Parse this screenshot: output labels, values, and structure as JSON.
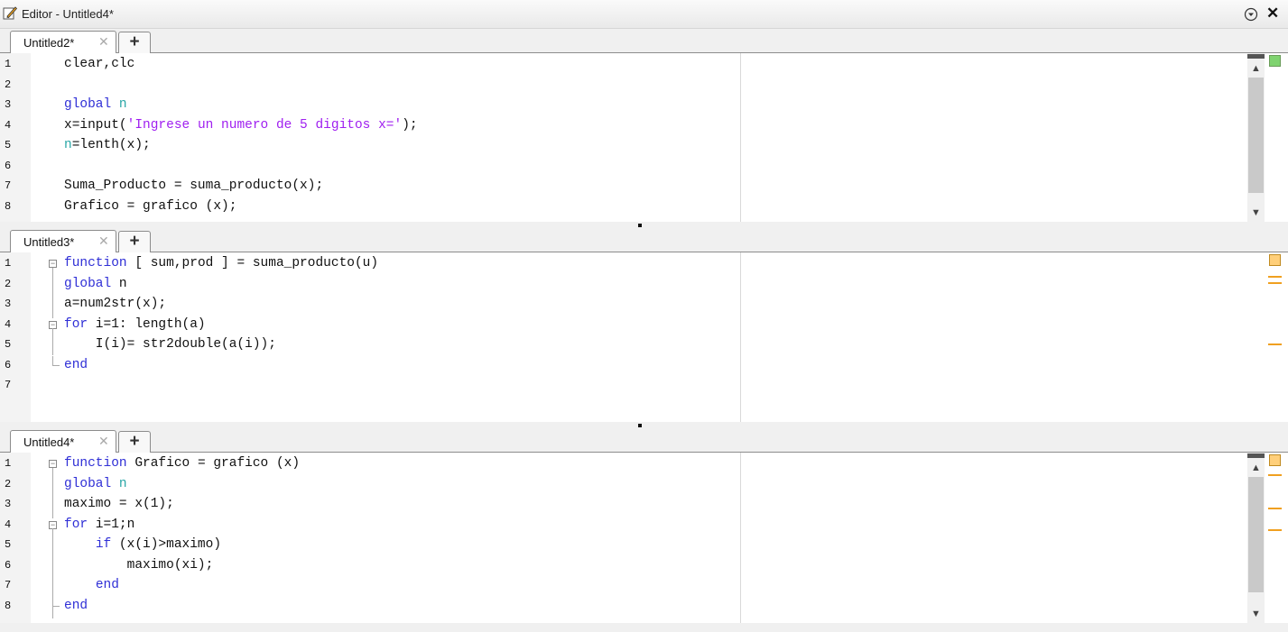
{
  "window": {
    "title": "Editor - Untitled4*",
    "menu_icon": "circle-down-icon",
    "close_label": "✕"
  },
  "panes": [
    {
      "tab_label": "Untitled2*",
      "lines": [
        {
          "n": "1",
          "code": "clear,clc"
        },
        {
          "n": "2",
          "code": ""
        },
        {
          "n": "3",
          "code": "global n"
        },
        {
          "n": "4",
          "code": "x=input('Ingrese un numero de 5 digitos x=');"
        },
        {
          "n": "5",
          "code": "n=lenth(x);"
        },
        {
          "n": "6",
          "code": ""
        },
        {
          "n": "7",
          "code": "Suma_Producto = suma_producto(x);"
        },
        {
          "n": "8",
          "code": "Grafico = grafico (x);"
        }
      ]
    },
    {
      "tab_label": "Untitled3*",
      "lines": [
        {
          "n": "1",
          "code": "function [ sum,prod ] = suma_producto(u)"
        },
        {
          "n": "2",
          "code": "global n"
        },
        {
          "n": "3",
          "code": "a=num2str(x);"
        },
        {
          "n": "4",
          "code": "for i=1: length(a)"
        },
        {
          "n": "5",
          "code": "    I(i)= str2double(a(i));"
        },
        {
          "n": "6",
          "code": "end"
        },
        {
          "n": "7",
          "code": ""
        }
      ]
    },
    {
      "tab_label": "Untitled4*",
      "lines": [
        {
          "n": "1",
          "code": "function Grafico = grafico (x)"
        },
        {
          "n": "2",
          "code": "global n"
        },
        {
          "n": "3",
          "code": "maximo = x(1);"
        },
        {
          "n": "4",
          "code": "for i=1;n"
        },
        {
          "n": "5",
          "code": "    if (x(i)>maximo)"
        },
        {
          "n": "6",
          "code": "        maximo(xi);"
        },
        {
          "n": "7",
          "code": "    end"
        },
        {
          "n": "8",
          "code": "end"
        }
      ]
    }
  ],
  "tab_close_glyph": "✕",
  "add_tab_glyph": "+",
  "scroll_up_glyph": "▲",
  "scroll_down_glyph": "▼",
  "colors": {
    "keyword": "#2f2fd6",
    "global_var": "#2aa7a7",
    "string": "#a020f0",
    "ok_indicator": "#7fd36f",
    "warning_indicator": "#ffcf7a",
    "warning_mark": "#f0a020"
  }
}
